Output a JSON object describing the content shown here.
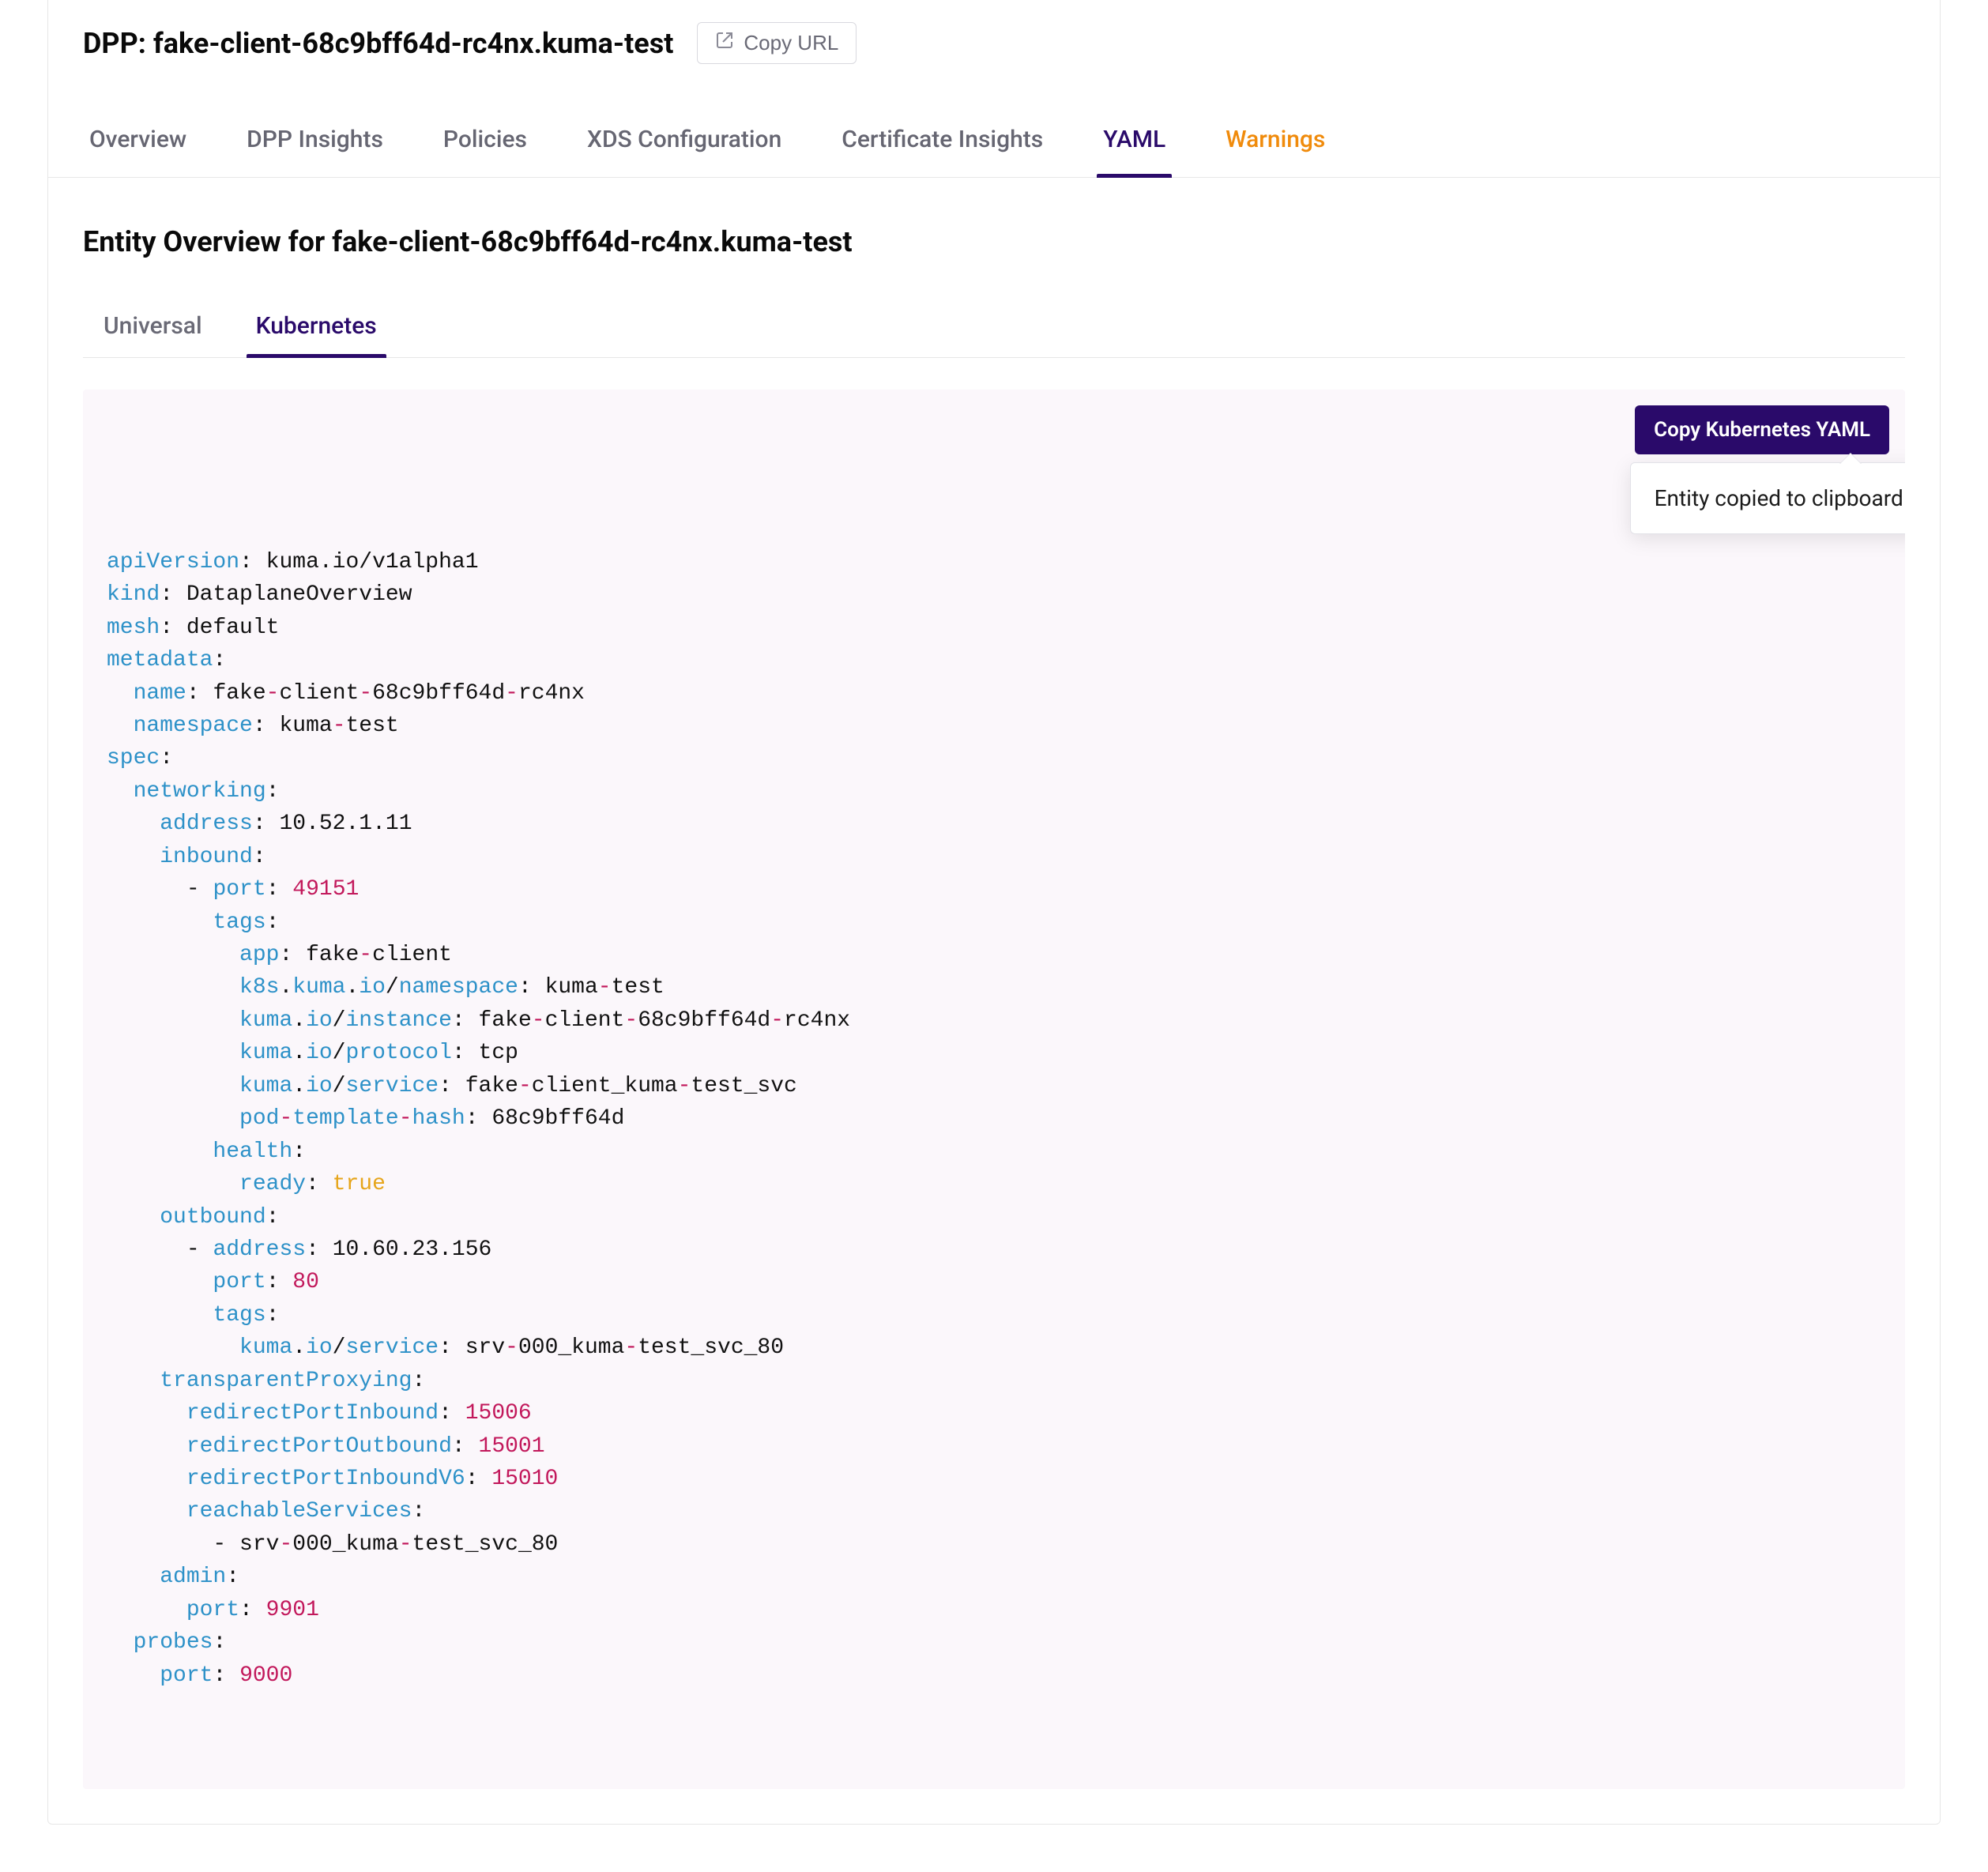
{
  "header": {
    "title_prefix": "DPP: ",
    "title_name": "fake-client-68c9bff64d-rc4nx.kuma-test",
    "copy_url_label": "Copy URL"
  },
  "main_tabs": [
    {
      "label": "Overview",
      "active": false,
      "warning": false
    },
    {
      "label": "DPP Insights",
      "active": false,
      "warning": false
    },
    {
      "label": "Policies",
      "active": false,
      "warning": false
    },
    {
      "label": "XDS Configuration",
      "active": false,
      "warning": false
    },
    {
      "label": "Certificate Insights",
      "active": false,
      "warning": false
    },
    {
      "label": "YAML",
      "active": true,
      "warning": false
    },
    {
      "label": "Warnings",
      "active": false,
      "warning": true
    }
  ],
  "entity_title_prefix": "Entity Overview for ",
  "entity_title_name": "fake-client-68c9bff64d-rc4nx.kuma-test",
  "sub_tabs": [
    {
      "label": "Universal",
      "active": false
    },
    {
      "label": "Kubernetes",
      "active": true
    }
  ],
  "copy_yaml_label": "Copy Kubernetes YAML",
  "tooltip_text": "Entity copied to clipboard!",
  "yaml": {
    "apiVersion": "kuma.io/v1alpha1",
    "kind": "DataplaneOverview",
    "mesh": "default",
    "metadata": {
      "name": "fake-client-68c9bff64d-rc4nx",
      "namespace": "kuma-test"
    },
    "spec": {
      "networking": {
        "address": "10.52.1.11",
        "inbound": [
          {
            "port": 49151,
            "tags": {
              "app": "fake-client",
              "k8s.kuma.io/namespace": "kuma-test",
              "kuma.io/instance": "fake-client-68c9bff64d-rc4nx",
              "kuma.io/protocol": "tcp",
              "kuma.io/service": "fake-client_kuma-test_svc",
              "pod-template-hash": "68c9bff64d"
            },
            "health": {
              "ready": true
            }
          }
        ],
        "outbound": [
          {
            "address": "10.60.23.156",
            "port": 80,
            "tags": {
              "kuma.io/service": "srv-000_kuma-test_svc_80"
            }
          }
        ],
        "transparentProxying": {
          "redirectPortInbound": 15006,
          "redirectPortOutbound": 15001,
          "redirectPortInboundV6": 15010,
          "reachableServices": [
            "srv-000_kuma-test_svc_80"
          ]
        },
        "admin": {
          "port": 9901
        }
      },
      "probes": {
        "port": 9000
      }
    }
  }
}
